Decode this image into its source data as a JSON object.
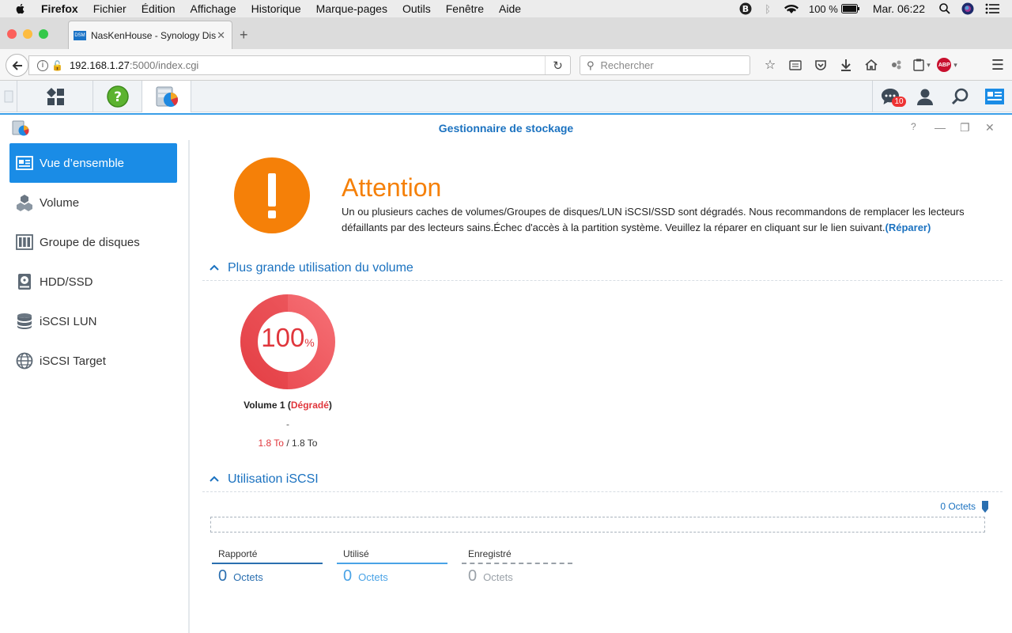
{
  "menubar": {
    "app": "Firefox",
    "items": [
      "Fichier",
      "Édition",
      "Affichage",
      "Historique",
      "Marque-pages",
      "Outils",
      "Fenêtre",
      "Aide"
    ],
    "battery": "100 %",
    "clock": "Mar. 06:22"
  },
  "browser": {
    "tab_title": "NasKenHouse - Synology DiskStation",
    "url_host": "192.168.1.27",
    "url_path": ":5000/index.cgi",
    "search_placeholder": "Rechercher",
    "abp_label": "ABP"
  },
  "dsm": {
    "notification_count": "10"
  },
  "window": {
    "title": "Gestionnaire de stockage"
  },
  "sidebar": {
    "items": [
      {
        "label": "Vue d’ensemble",
        "icon": "overview-icon"
      },
      {
        "label": "Volume",
        "icon": "volume-icon"
      },
      {
        "label": "Groupe de disques",
        "icon": "disk-group-icon"
      },
      {
        "label": "HDD/SSD",
        "icon": "hdd-icon"
      },
      {
        "label": "iSCSI LUN",
        "icon": "iscsi-lun-icon"
      },
      {
        "label": "iSCSI Target",
        "icon": "iscsi-target-icon"
      }
    ]
  },
  "alert": {
    "title": "Attention",
    "message": "Un ou plusieurs caches de volumes/Groupes de disques/LUN iSCSI/SSD sont dégradés. Nous recommandons de remplacer les lecteurs défaillants par des lecteurs sains.Échec d'accès à la partition système. Veuillez la réparer en cliquant sur le lien suivant.",
    "link": "(Réparer)",
    "color": "#f58008"
  },
  "volume_usage": {
    "section_title": "Plus grande utilisation du volume",
    "percent": "100",
    "percent_sign": "%",
    "percent_value": 100,
    "volume_name": "Volume 1",
    "status": "Dégradé",
    "dash": "-",
    "used": "1.8 To",
    "separator": " / ",
    "total": "1.8 To",
    "color": "#e0363c"
  },
  "iscsi": {
    "section_title": "Utilisation iSCSI",
    "total": "0 Octets",
    "stats": [
      {
        "label": "Rapporté",
        "value": "0",
        "unit": "Octets",
        "color": "#2a6fb0"
      },
      {
        "label": "Utilisé",
        "value": "0",
        "unit": "Octets",
        "color": "#4aa3e6"
      },
      {
        "label": "Enregistré",
        "value": "0",
        "unit": "Octets",
        "color": "#9aa1a8"
      }
    ]
  }
}
